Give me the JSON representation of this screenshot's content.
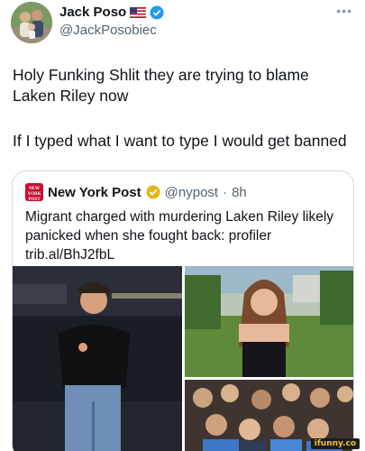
{
  "author": {
    "display_name": "Jack Poso",
    "handle": "@JackPosobiec",
    "flag_icon": "us-flag-icon",
    "verified_icon": "verified-badge-icon",
    "verified_color": "#1d9bf0"
  },
  "tweet": {
    "line1": "Holy Funking Shlit they are trying to blame Laken Riley now",
    "line2": "If I typed what I want to type I would get banned"
  },
  "quote": {
    "logo_text": "NEW YORK POST",
    "display_name": "New York Post",
    "verified_color": "#e2b719",
    "handle": "@nypost",
    "separator": "·",
    "time": "8h",
    "text": "Migrant charged with murdering Laken Riley likely panicked when she fought back: profiler trib.al/BhJ2fbL"
  },
  "watermark": "ifunny.co"
}
